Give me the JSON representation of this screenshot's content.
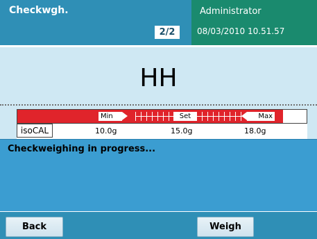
{
  "header": {
    "title": "Checkwgh.",
    "page_indicator": "2/2",
    "user": "Administrator",
    "datetime": "08/03/2010 10.51.57"
  },
  "display": {
    "value": "HH"
  },
  "tolerance_bar": {
    "min_label": "Min",
    "set_label": "Set",
    "max_label": "Max"
  },
  "scale": {
    "iso_label": "isoCAL",
    "min_value": "10.0g",
    "set_value": "15.0g",
    "max_value": "18.0g"
  },
  "status": {
    "message": "Checkweighing in progress..."
  },
  "footer": {
    "back_label": "Back",
    "weigh_label": "Weigh"
  },
  "colors": {
    "header_blue": "#2f8fb6",
    "user_panel_green": "#1a8a6e",
    "display_bg": "#cfe8f3",
    "status_bg": "#3b9dd1",
    "tolerance_red": "#e0242b"
  }
}
